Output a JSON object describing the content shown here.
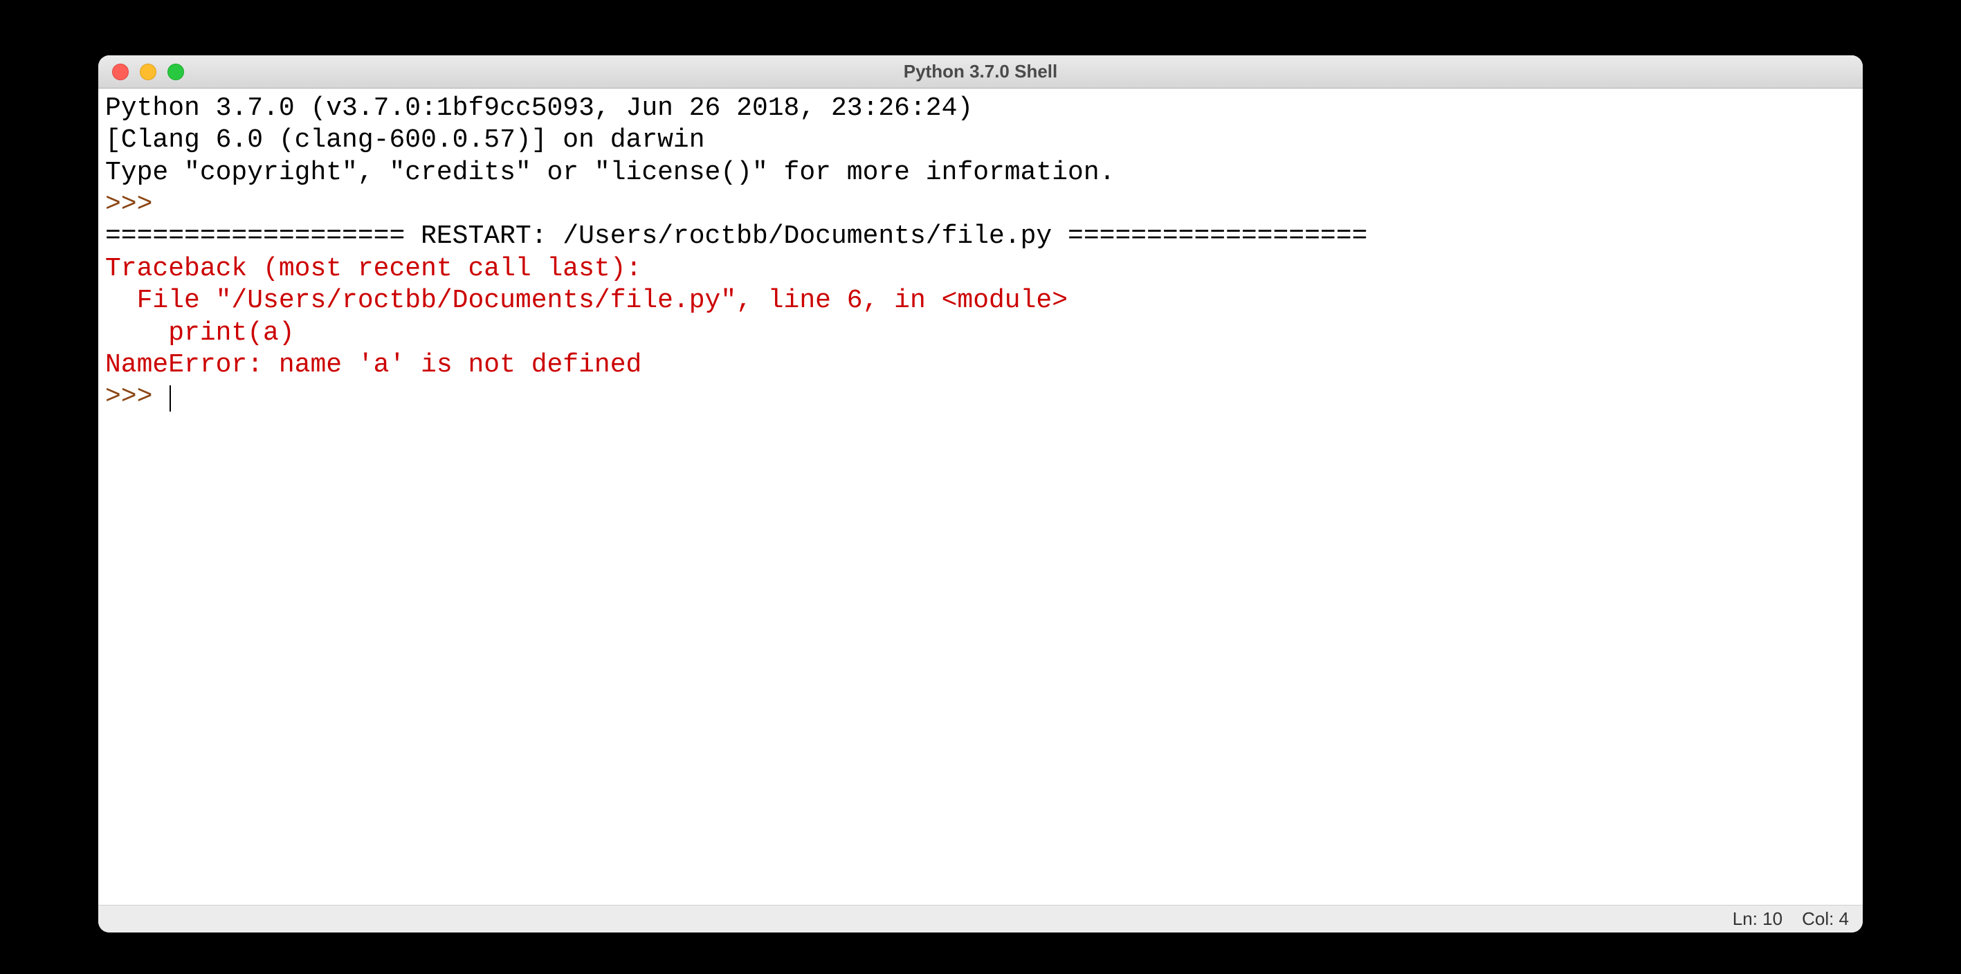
{
  "window": {
    "title": "Python 3.7.0 Shell"
  },
  "shell": {
    "banner_line1": "Python 3.7.0 (v3.7.0:1bf9cc5093, Jun 26 2018, 23:26:24) ",
    "banner_line2": "[Clang 6.0 (clang-600.0.57)] on darwin",
    "banner_line3": "Type \"copyright\", \"credits\" or \"license()\" for more information.",
    "prompt1": ">>> ",
    "restart_line": "=================== RESTART: /Users/roctbb/Documents/file.py ===================",
    "traceback_line1": "Traceback (most recent call last):",
    "traceback_line2": "  File \"/Users/roctbb/Documents/file.py\", line 6, in <module>",
    "traceback_line3": "    print(a)",
    "traceback_line4": "NameError: name 'a' is not defined",
    "prompt2": ">>> "
  },
  "status": {
    "line": "Ln: 10",
    "col": "Col: 4"
  }
}
